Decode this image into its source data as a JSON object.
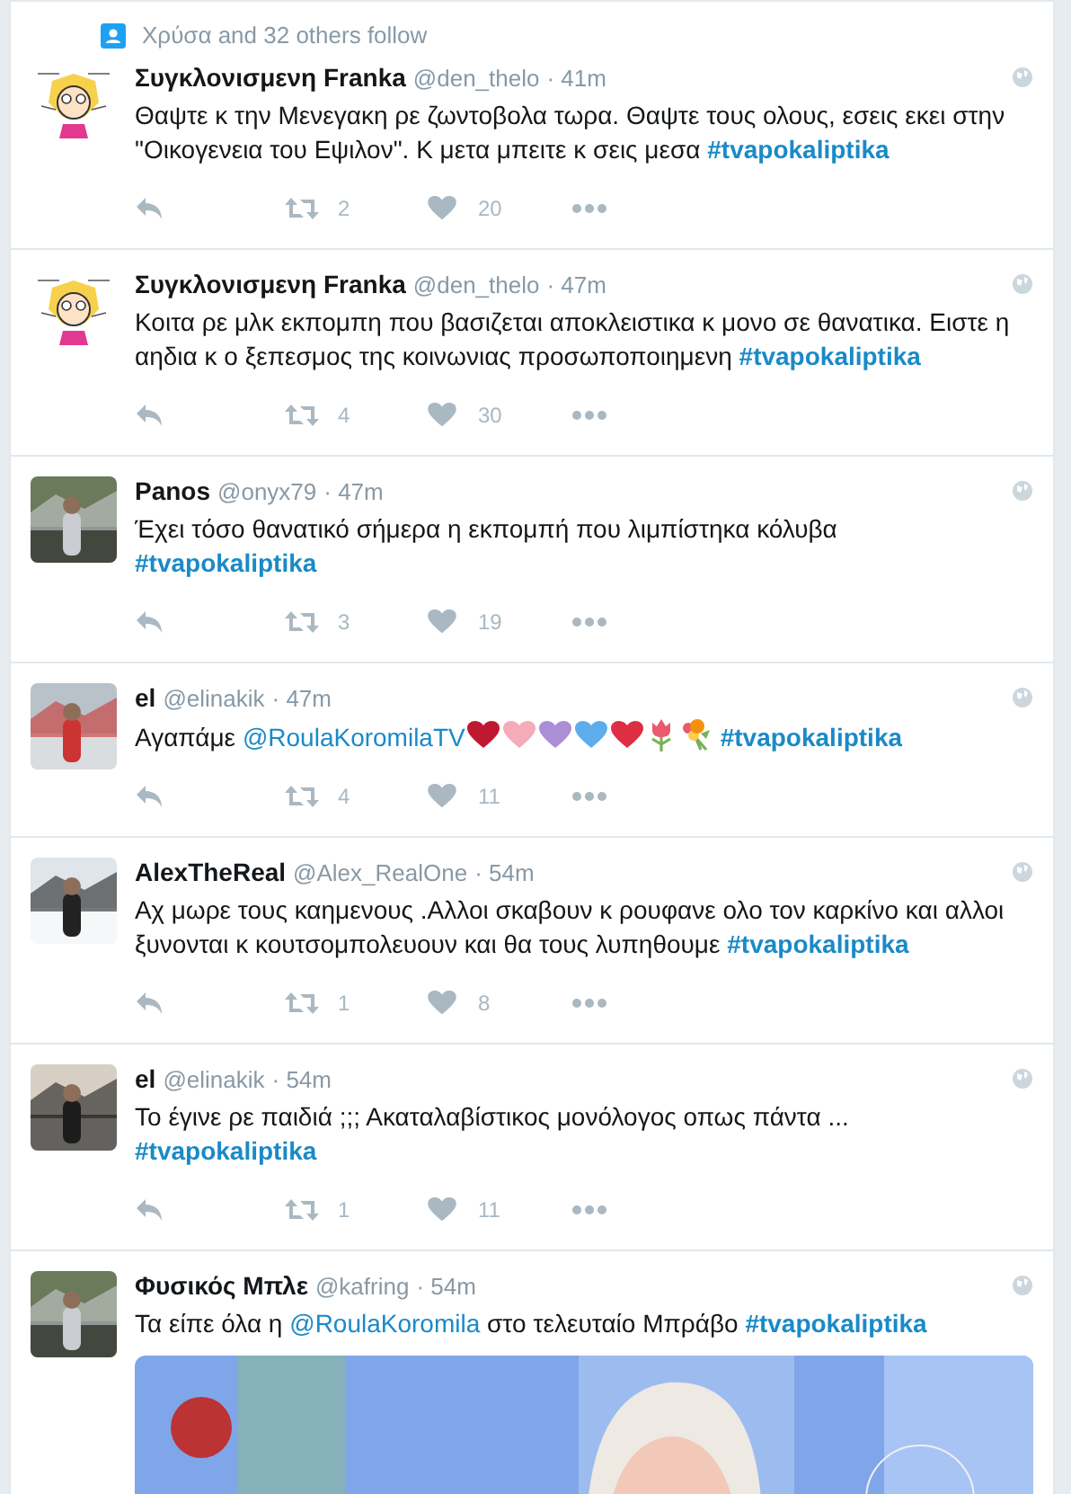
{
  "tweets": [
    {
      "context": "Χρύσα and 32 others follow",
      "avatar": {
        "kind": "cartoon"
      },
      "name": "Συγκλονισμενη Franka",
      "handle": "@den_thelo",
      "time": "· 41m",
      "body": [
        {
          "kind": "text",
          "text": "Θαψτε κ την Μενεγακη ρε ζωντοβολα τωρα. Θαψτε τους ολους, εσεις εκει στην \"Οικογενεια του Εψιλον\". Κ μετα μπειτε κ σεις μεσα "
        },
        {
          "kind": "hashtag",
          "text": "#tvapokaliptika"
        }
      ],
      "retweets": "2",
      "likes": "20"
    },
    {
      "avatar": {
        "kind": "cartoon"
      },
      "name": "Συγκλονισμενη Franka",
      "handle": "@den_thelo",
      "time": "· 47m",
      "body": [
        {
          "kind": "text",
          "text": "Κοιτα ρε μλκ εκπομπη που βασιζεται αποκλειστικα κ μονο σε θανατικα. Ειστε η αηδια κ ο ξεπεσμος της κοινωνιας προσωποποιημενη "
        },
        {
          "kind": "hashtag",
          "text": "#tvapokaliptika"
        }
      ],
      "retweets": "4",
      "likes": "30"
    },
    {
      "name": "Panos",
      "handle": "@onyx79",
      "time": "· 47m",
      "body": [
        {
          "kind": "text",
          "text": "Έχει τόσο θανατικό σήμερα η εκπομπή που λιμπίστηκα κόλυβα "
        },
        {
          "kind": "hashtag",
          "text": "#tvapokaliptika"
        }
      ],
      "retweets": "3",
      "likes": "19"
    },
    {
      "name": "el",
      "handle": "@elinakik",
      "time": "· 47m",
      "body": [
        {
          "kind": "text",
          "text": "Αγαπάμε "
        },
        {
          "kind": "mention",
          "text": "@RoulaKoromilaTV"
        },
        {
          "kind": "heart",
          "color": "#be1931"
        },
        {
          "kind": "heart",
          "color": "#f4abba"
        },
        {
          "kind": "heart",
          "color": "#aa8ed6"
        },
        {
          "kind": "heart",
          "color": "#5dadec"
        },
        {
          "kind": "heart",
          "color": "#dd2e44"
        },
        {
          "kind": "tulip",
          "color": "#ea596e"
        },
        {
          "kind": "bouquet",
          "color": "#f4900c"
        },
        {
          "kind": "hashtag",
          "text": "#tvapokaliptika"
        }
      ],
      "retweets": "4",
      "likes": "11"
    },
    {
      "name": "AlexTheReal",
      "handle": "@Alex_RealOne",
      "time": "· 54m",
      "body": [
        {
          "kind": "text",
          "text": "Αχ μωρε τους καημενους .Αλλοι σκαβουν κ ρουφανε ολο τον καρκίνο και αλλοι ξυνονται κ κουτσομπολευουν και θα τους λυπηθουμε  "
        },
        {
          "kind": "hashtag",
          "text": "#tvapokaliptika"
        }
      ],
      "retweets": "1",
      "likes": "8"
    },
    {
      "name": "el",
      "handle": "@elinakik",
      "time": "· 54m",
      "body": [
        {
          "kind": "text",
          "text": "Το έγινε ρε παιδιά ;;; Ακαταλαβίστικος μονόλογος οπως πάντα ... "
        },
        {
          "kind": "hashtag",
          "text": "#tvapokaliptika"
        }
      ],
      "retweets": "1",
      "likes": "11"
    },
    {
      "name": "Φυσικός Μπλε",
      "handle": "@kafring",
      "time": "· 54m",
      "body": [
        {
          "kind": "text",
          "text": "Τα είπε όλα η "
        },
        {
          "kind": "mention",
          "text": "@RoulaKoromila"
        },
        {
          "kind": "text",
          "text": " στο τελευταίο Μπράβο "
        },
        {
          "kind": "hashtag",
          "text": "#tvapokaliptika"
        }
      ]
    }
  ]
}
